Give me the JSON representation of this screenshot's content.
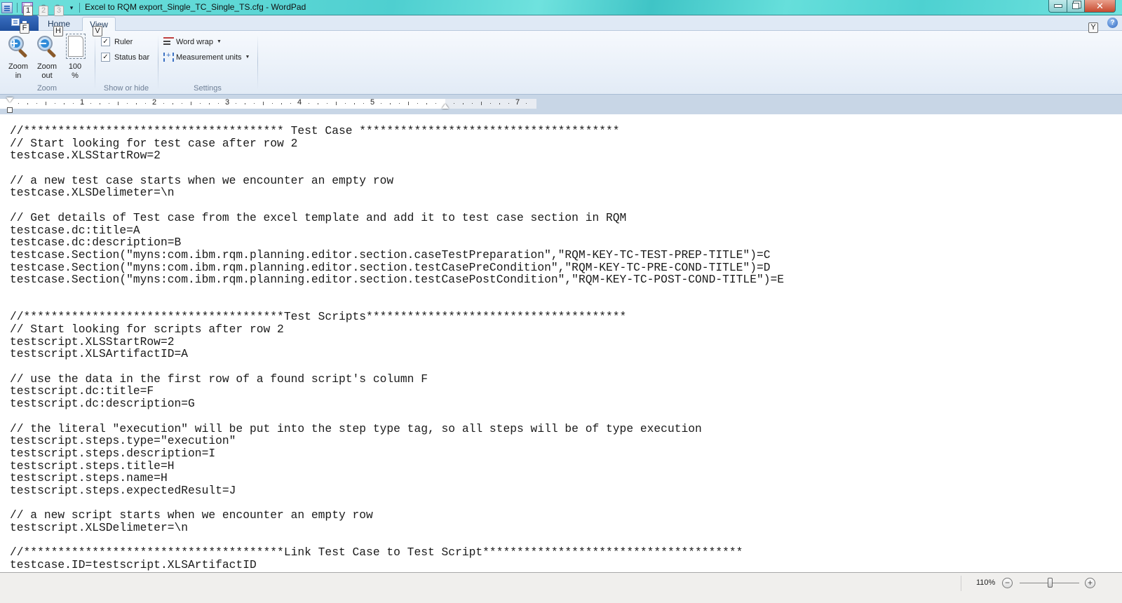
{
  "window": {
    "title": "Excel to RQM export_Single_TC_Single_TS.cfg - WordPad",
    "close_glyph": "✕"
  },
  "quick_access": {
    "keytips": [
      "1",
      "2",
      "3"
    ],
    "more_glyph": "▾",
    "undo_glyph": "↶",
    "redo_glyph": "↷"
  },
  "ribbon": {
    "tabs": [
      {
        "label": "Home",
        "keytip": "H"
      },
      {
        "label": "View",
        "keytip": "V",
        "active": true
      }
    ],
    "app_menu_keytip": "F",
    "help_glyph": "?",
    "help_keytip": "Y",
    "groups": {
      "zoom": {
        "label": "Zoom",
        "buttons": [
          {
            "label_1": "Zoom",
            "label_2": "in",
            "icon": "zoom-in-icon"
          },
          {
            "label_1": "Zoom",
            "label_2": "out",
            "icon": "zoom-out-icon"
          },
          {
            "label_1": "100",
            "label_2": "%",
            "icon": "page-100-icon"
          }
        ]
      },
      "show_or_hide": {
        "label": "Show or hide",
        "checkboxes": [
          {
            "label": "Ruler",
            "checked": true
          },
          {
            "label": "Status bar",
            "checked": true
          }
        ],
        "check_glyph": "✓"
      },
      "settings": {
        "label": "Settings",
        "items": [
          {
            "label": "Word wrap",
            "icon": "word-wrap-icon"
          },
          {
            "label": "Measurement units",
            "icon": "measurement-units-icon"
          }
        ],
        "dropdown_glyph": "▼"
      }
    }
  },
  "ruler": {
    "numbers": [
      "1",
      "2",
      "3",
      "4",
      "5",
      "7"
    ]
  },
  "document": {
    "lines": [
      "//************************************** Test Case **************************************",
      "// Start looking for test case after row 2",
      "testcase.XLSStartRow=2",
      "",
      "// a new test case starts when we encounter an empty row",
      "testcase.XLSDelimeter=\\n",
      "",
      "// Get details of Test case from the excel template and add it to test case section in RQM",
      "testcase.dc:title=A",
      "testcase.dc:description=B",
      "testcase.Section(\"myns:com.ibm.rqm.planning.editor.section.caseTestPreparation\",\"RQM-KEY-TC-TEST-PREP-TITLE\")=C",
      "testcase.Section(\"myns:com.ibm.rqm.planning.editor.section.testCasePreCondition\",\"RQM-KEY-TC-PRE-COND-TITLE\")=D",
      "testcase.Section(\"myns:com.ibm.rqm.planning.editor.section.testCasePostCondition\",\"RQM-KEY-TC-POST-COND-TITLE\")=E",
      "",
      "",
      "//**************************************Test Scripts**************************************",
      "// Start looking for scripts after row 2",
      "testscript.XLSStartRow=2",
      "testscript.XLSArtifactID=A",
      "",
      "// use the data in the first row of a found script's column F",
      "testscript.dc:title=F",
      "testscript.dc:description=G",
      "",
      "// the literal \"execution\" will be put into the step type tag, so all steps will be of type execution",
      "testscript.steps.type=\"execution\"",
      "testscript.steps.description=I",
      "testscript.steps.title=H",
      "testscript.steps.name=H",
      "testscript.steps.expectedResult=J",
      "",
      "// a new script starts when we encounter an empty row",
      "testscript.XLSDelimeter=\\n",
      "",
      "//**************************************Link Test Case to Test Script**************************************",
      "testcase.ID=testscript.XLSArtifactID"
    ]
  },
  "statusbar": {
    "zoom_level": "110%",
    "zoom_out_glyph": "−",
    "zoom_in_glyph": "+",
    "zoom_percent": 110
  }
}
